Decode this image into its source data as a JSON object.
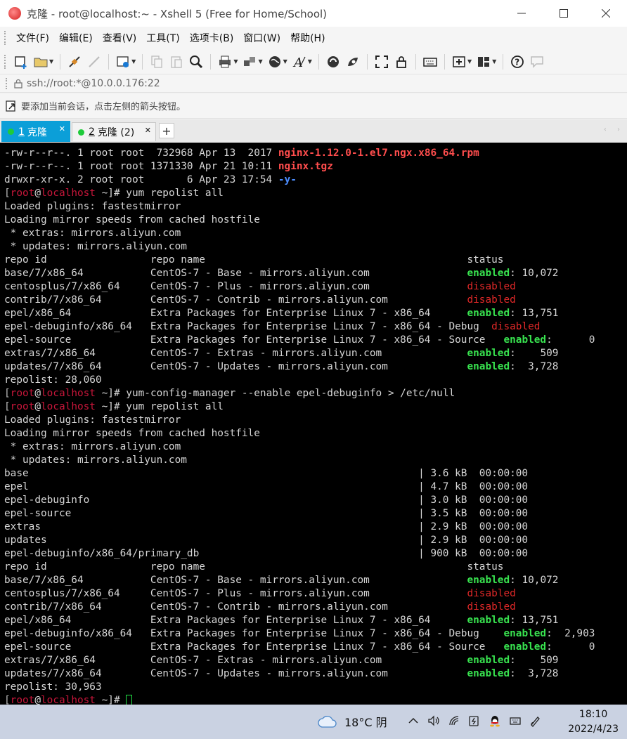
{
  "window": {
    "title": "克隆 - root@localhost:~ - Xshell 5 (Free for Home/School)"
  },
  "menu": [
    "文件(F)",
    "编辑(E)",
    "查看(V)",
    "工具(T)",
    "选项卡(B)",
    "窗口(W)",
    "帮助(H)"
  ],
  "address": {
    "text": "ssh://root:*@10.0.0.176:22"
  },
  "hint": {
    "text": "要添加当前会话，点击左侧的箭头按钮。"
  },
  "tabs": [
    {
      "number": "1",
      "label": "克隆"
    },
    {
      "number": "2",
      "label": "克隆 (2)"
    }
  ],
  "terminal": {
    "lines": [
      [
        {
          "t": "-rw-r--r--. 1 root root  732968 Apr 13  2017 "
        },
        {
          "t": "nginx-1.12.0-1.el7.ngx.x86_64.rpm",
          "c": "c-red"
        }
      ],
      [
        {
          "t": "-rw-r--r--. 1 root root 1371330 Apr 21 10:11 "
        },
        {
          "t": "nginx.tgz",
          "c": "c-red"
        }
      ],
      [
        {
          "t": "drwxr-xr-x. 2 root root       6 Apr 23 17:54 "
        },
        {
          "t": "-y-",
          "c": "c-blue"
        }
      ],
      [
        {
          "t": "[",
          "c": "c-br"
        },
        {
          "t": "root",
          "c": "c-host"
        },
        {
          "t": "@"
        },
        {
          "t": "localhost",
          "c": "c-host"
        },
        {
          "t": " ~]# yum repolist all"
        }
      ],
      [
        {
          "t": "Loaded plugins: fastestmirror"
        }
      ],
      [
        {
          "t": "Loading mirror speeds from cached hostfile"
        }
      ],
      [
        {
          "t": " * extras: mirrors.aliyun.com"
        }
      ],
      [
        {
          "t": " * updates: mirrors.aliyun.com"
        }
      ],
      [
        {
          "t": "repo id                 repo name                                           status"
        }
      ],
      [
        {
          "t": "base/7/x86_64           CentOS-7 - Base - mirrors.aliyun.com                "
        },
        {
          "t": "enabled",
          "c": "c-green"
        },
        {
          "t": ": 10,072"
        }
      ],
      [
        {
          "t": "centosplus/7/x86_64     CentOS-7 - Plus - mirrors.aliyun.com                "
        },
        {
          "t": "disabled",
          "c": "c-dis"
        }
      ],
      [
        {
          "t": "contrib/7/x86_64        CentOS-7 - Contrib - mirrors.aliyun.com             "
        },
        {
          "t": "disabled",
          "c": "c-dis"
        }
      ],
      [
        {
          "t": "epel/x86_64             Extra Packages for Enterprise Linux 7 - x86_64      "
        },
        {
          "t": "enabled",
          "c": "c-green"
        },
        {
          "t": ": 13,751"
        }
      ],
      [
        {
          "t": "epel-debuginfo/x86_64   Extra Packages for Enterprise Linux 7 - x86_64 - Debug  "
        },
        {
          "t": "disabled",
          "c": "c-dis"
        }
      ],
      [
        {
          "t": "epel-source             Extra Packages for Enterprise Linux 7 - x86_64 - Source   "
        },
        {
          "t": "enabled",
          "c": "c-green"
        },
        {
          "t": ":      0"
        }
      ],
      [
        {
          "t": "extras/7/x86_64         CentOS-7 - Extras - mirrors.aliyun.com              "
        },
        {
          "t": "enabled",
          "c": "c-green"
        },
        {
          "t": ":    509"
        }
      ],
      [
        {
          "t": "updates/7/x86_64        CentOS-7 - Updates - mirrors.aliyun.com             "
        },
        {
          "t": "enabled",
          "c": "c-green"
        },
        {
          "t": ":  3,728"
        }
      ],
      [
        {
          "t": "repolist: 28,060"
        }
      ],
      [
        {
          "t": "[",
          "c": "c-br"
        },
        {
          "t": "root",
          "c": "c-host"
        },
        {
          "t": "@"
        },
        {
          "t": "localhost",
          "c": "c-host"
        },
        {
          "t": " ~]# yum-config-manager --enable epel-debuginfo > /etc/null"
        }
      ],
      [
        {
          "t": "[",
          "c": "c-br"
        },
        {
          "t": "root",
          "c": "c-host"
        },
        {
          "t": "@"
        },
        {
          "t": "localhost",
          "c": "c-host"
        },
        {
          "t": " ~]# yum repolist all"
        }
      ],
      [
        {
          "t": "Loaded plugins: fastestmirror"
        }
      ],
      [
        {
          "t": "Loading mirror speeds from cached hostfile"
        }
      ],
      [
        {
          "t": " * extras: mirrors.aliyun.com"
        }
      ],
      [
        {
          "t": " * updates: mirrors.aliyun.com"
        }
      ],
      [
        {
          "t": "base                                                                | 3.6 kB  00:00:00"
        }
      ],
      [
        {
          "t": "epel                                                                | 4.7 kB  00:00:00"
        }
      ],
      [
        {
          "t": "epel-debuginfo                                                      | 3.0 kB  00:00:00"
        }
      ],
      [
        {
          "t": "epel-source                                                         | 3.5 kB  00:00:00"
        }
      ],
      [
        {
          "t": "extras                                                              | 2.9 kB  00:00:00"
        }
      ],
      [
        {
          "t": "updates                                                             | 2.9 kB  00:00:00"
        }
      ],
      [
        {
          "t": "epel-debuginfo/x86_64/primary_db                                    | 900 kB  00:00:00"
        }
      ],
      [
        {
          "t": "repo id                 repo name                                           status"
        }
      ],
      [
        {
          "t": "base/7/x86_64           CentOS-7 - Base - mirrors.aliyun.com                "
        },
        {
          "t": "enabled",
          "c": "c-green"
        },
        {
          "t": ": 10,072"
        }
      ],
      [
        {
          "t": "centosplus/7/x86_64     CentOS-7 - Plus - mirrors.aliyun.com                "
        },
        {
          "t": "disabled",
          "c": "c-dis"
        }
      ],
      [
        {
          "t": "contrib/7/x86_64        CentOS-7 - Contrib - mirrors.aliyun.com             "
        },
        {
          "t": "disabled",
          "c": "c-dis"
        }
      ],
      [
        {
          "t": "epel/x86_64             Extra Packages for Enterprise Linux 7 - x86_64      "
        },
        {
          "t": "enabled",
          "c": "c-green"
        },
        {
          "t": ": 13,751"
        }
      ],
      [
        {
          "t": "epel-debuginfo/x86_64   Extra Packages for Enterprise Linux 7 - x86_64 - Debug    "
        },
        {
          "t": "enabled",
          "c": "c-green"
        },
        {
          "t": ":  2,903"
        }
      ],
      [
        {
          "t": "epel-source             Extra Packages for Enterprise Linux 7 - x86_64 - Source   "
        },
        {
          "t": "enabled",
          "c": "c-green"
        },
        {
          "t": ":      0"
        }
      ],
      [
        {
          "t": "extras/7/x86_64         CentOS-7 - Extras - mirrors.aliyun.com              "
        },
        {
          "t": "enabled",
          "c": "c-green"
        },
        {
          "t": ":    509"
        }
      ],
      [
        {
          "t": "updates/7/x86_64        CentOS-7 - Updates - mirrors.aliyun.com             "
        },
        {
          "t": "enabled",
          "c": "c-green"
        },
        {
          "t": ":  3,728"
        }
      ],
      [
        {
          "t": "repolist: 30,963"
        }
      ],
      [
        {
          "t": "[",
          "c": "c-br"
        },
        {
          "t": "root",
          "c": "c-host"
        },
        {
          "t": "@"
        },
        {
          "t": "localhost",
          "c": "c-host"
        },
        {
          "t": " ~]# "
        },
        {
          "t": "",
          "c": "cursor"
        }
      ]
    ]
  },
  "taskbar": {
    "weather": "18°C 阴",
    "time": "18:10",
    "date": "2022/4/23"
  }
}
